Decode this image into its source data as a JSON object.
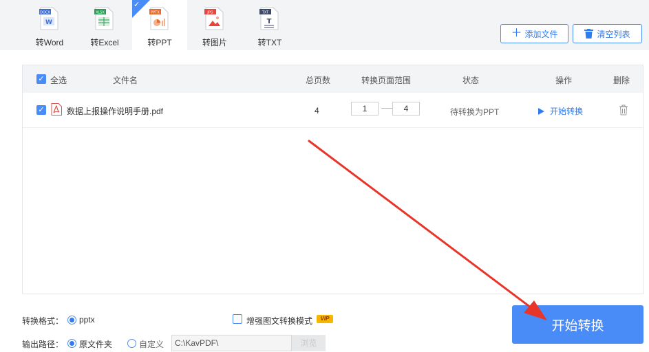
{
  "tabs": [
    {
      "label": "转Word",
      "icon": "word-file-icon",
      "tag": "DOCX",
      "color": "#3b6fd6",
      "active": false
    },
    {
      "label": "转Excel",
      "icon": "excel-file-icon",
      "tag": "XLSX",
      "color": "#2e9b57",
      "active": false
    },
    {
      "label": "转PPT",
      "icon": "ppt-file-icon",
      "tag": "PPTX",
      "color": "#e86a2c",
      "active": true
    },
    {
      "label": "转图片",
      "icon": "image-file-icon",
      "tag": "JPG",
      "color": "#e8453c",
      "active": false
    },
    {
      "label": "转TXT",
      "icon": "txt-file-icon",
      "tag": "TXT",
      "color": "#3c4a6b",
      "active": false
    }
  ],
  "toolbar": {
    "add_file": "添加文件",
    "clear_list": "清空列表"
  },
  "table": {
    "headers": {
      "select_all": "全选",
      "filename": "文件名",
      "total_pages": "总页数",
      "page_range": "转换页面范围",
      "status": "状态",
      "action": "操作",
      "delete": "删除"
    },
    "rows": [
      {
        "checked": true,
        "filename": "数据上报操作说明手册.pdf",
        "total_pages": "4",
        "range_from": "1",
        "range_to": "4",
        "status": "待转换为PPT",
        "action": "开始转换"
      }
    ]
  },
  "options": {
    "format_label": "转换格式：",
    "format_value": "pptx",
    "enhance_label": "增强图文转换模式",
    "vip_badge": "VIP",
    "output_label": "输出路径：",
    "output_source": "原文件夹",
    "output_custom": "自定义",
    "output_path": "C:\\KavPDF\\",
    "browse": "浏览"
  },
  "start_button": "开始转换",
  "colors": {
    "accent": "#4a8cf7",
    "link": "#2f7bf0",
    "arrow": "#e8352a"
  }
}
